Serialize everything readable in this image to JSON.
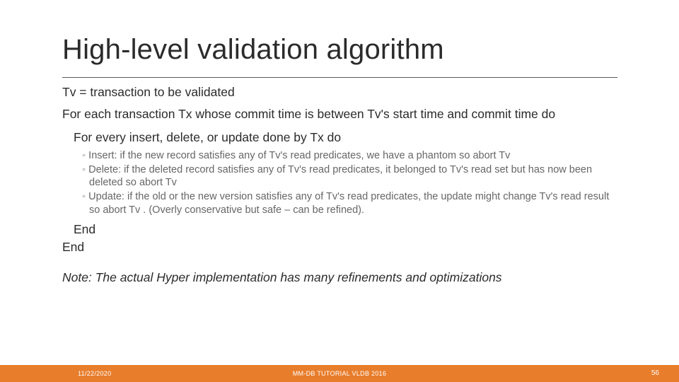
{
  "title": "High-level validation algorithm",
  "body": {
    "line1": "Tv = transaction to be validated",
    "line2": "For each transaction Tx whose commit time is between Tv's start time and commit time do",
    "line3": "For every insert, delete, or update done by Tx do",
    "bullets": [
      "Insert:  if the new record satisfies any of Tv's read predicates, we have a phantom so abort Tv",
      "Delete: if the deleted  record satisfies any  of Tv's read predicates, it belonged to Tv's read set but has now been deleted so abort Tv",
      "Update: if the old or the new version satisfies any of Tv's read predicates, the update might change Tv's read result so abort Tv . (Overly conservative but safe – can be refined)."
    ],
    "end_inner": "End",
    "end_outer": "End",
    "note": "Note: The actual Hyper implementation has many refinements and optimizations"
  },
  "footer": {
    "date": "11/22/2020",
    "center": "MM-DB TUTORIAL VLDB 2016",
    "page": "56"
  }
}
